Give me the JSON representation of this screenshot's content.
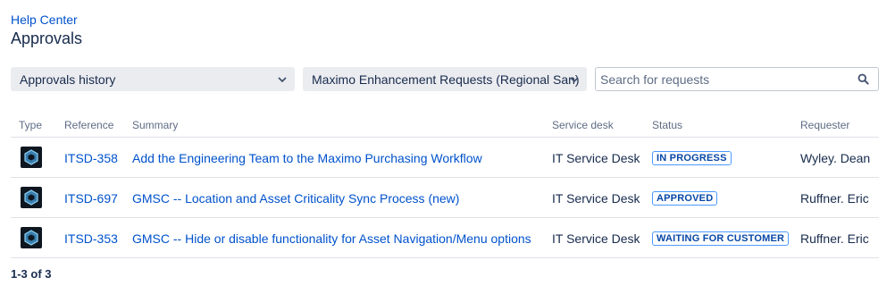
{
  "header": {
    "breadcrumb": "Help Center",
    "title": "Approvals"
  },
  "filters": {
    "history_select": "Approvals history",
    "project_select": "Maximo Enhancement Requests (Regional San)",
    "search_placeholder": "Search for requests"
  },
  "table": {
    "columns": [
      "Type",
      "Reference",
      "Summary",
      "Service desk",
      "Status",
      "Requester"
    ],
    "rows": [
      {
        "type_icon": "request-type-icon",
        "reference": "ITSD-358",
        "summary": "Add the Engineering Team to the Maximo Purchasing Workflow",
        "service_desk": "IT Service Desk",
        "status": "IN PROGRESS",
        "requester": "Wyley. Dean"
      },
      {
        "type_icon": "request-type-icon",
        "reference": "ITSD-697",
        "summary": "GMSC -- Location and Asset Criticality Sync Process (new)",
        "service_desk": "IT Service Desk",
        "status": "APPROVED",
        "requester": "Ruffner. Eric"
      },
      {
        "type_icon": "request-type-icon",
        "reference": "ITSD-353",
        "summary": "GMSC -- Hide or disable functionality for Asset Navigation/Menu options",
        "service_desk": "IT Service Desk",
        "status": "WAITING FOR CUSTOMER",
        "requester": "Ruffner. Eric"
      }
    ]
  },
  "pagination": {
    "summary": "1-3 of 3"
  },
  "colors": {
    "link": "#0052cc",
    "text": "#172b4d",
    "muted": "#5e6c84",
    "select_bg": "#ebecf0",
    "lozenge_border": "#4c9aff",
    "lozenge_text": "#0747a6"
  }
}
